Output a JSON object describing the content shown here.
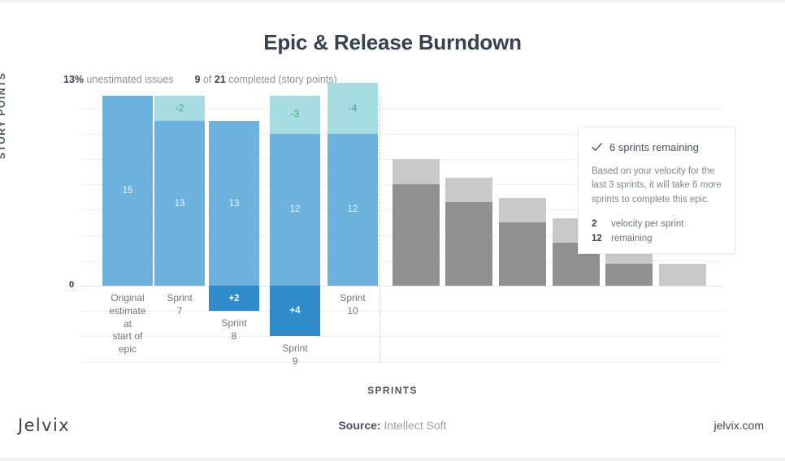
{
  "header": {
    "title": "Epic & Release Burndown"
  },
  "stats": [
    {
      "value": "13%",
      "label": "unestimated issues"
    },
    {
      "value": "9",
      "mid": "of",
      "value2": "21",
      "label": "completed (story points)"
    }
  ],
  "stats_flat": {
    "unestimated_value": "13%",
    "unestimated_label": "unestimated issues",
    "completed_value": "9",
    "completed_of": "of",
    "completed_total": "21",
    "completed_label": "completed (story points)"
  },
  "axes": {
    "y_title": "STORY POINTS",
    "x_title": "SPRINTS",
    "zero_tick": "0"
  },
  "info_card": {
    "heading": "6 sprints remaining",
    "body": "Based on your velocity for the last 3 sprints, it will take 6 more sprints to complete this epic.",
    "metrics": [
      {
        "num": "2",
        "text": "velocity per sprint"
      },
      {
        "num": "12",
        "text": "remaining"
      }
    ]
  },
  "footer": {
    "logo": "Jelvix",
    "source_strong": "Source:",
    "source_text": "Intellect Soft",
    "site": "jelvix.com"
  },
  "colors": {
    "mid_blue": "#6cb2dc",
    "light_cyan": "#a5dbe1",
    "dark_blue": "#2f8bc9",
    "gray_dark": "#909090",
    "gray_light": "#c9c9c9",
    "title": "#36424f",
    "green_label": "#3faa7e"
  },
  "chart_data": {
    "type": "bar",
    "title": "Epic & Release Burndown",
    "xlabel": "SPRINTS",
    "ylabel": "STORY POINTS",
    "grid": true,
    "legend": "none",
    "baseline": 0,
    "ylim": [
      -5,
      16
    ],
    "note": "Stacked burndown: positive segments rise above the 0 baseline, '+N' scope-added segments extend below it.",
    "categories": [
      "Original estimate at start of epic",
      "Sprint 7",
      "Sprint 8",
      "Sprint 9",
      "Sprint 10",
      "",
      "",
      "",
      "",
      "",
      ""
    ],
    "actual_bars": [
      {
        "category": "Original estimate at start of epic",
        "label": "Original\nestimate at\nstart of epic",
        "segments": [
          {
            "kind": "remaining",
            "value": 15,
            "text": "15",
            "color": "#6cb2dc"
          }
        ]
      },
      {
        "category": "Sprint 7",
        "label": "Sprint 7",
        "segments": [
          {
            "kind": "completed",
            "value": -2,
            "text": "-2",
            "color": "#a5dbe1"
          },
          {
            "kind": "remaining",
            "value": 13,
            "text": "13",
            "color": "#6cb2dc"
          }
        ]
      },
      {
        "category": "Sprint 8",
        "label": "Sprint 8",
        "segments": [
          {
            "kind": "remaining",
            "value": 13,
            "text": "13",
            "color": "#6cb2dc"
          },
          {
            "kind": "added",
            "value": 2,
            "text": "+2",
            "color": "#2f8bc9"
          }
        ]
      },
      {
        "category": "Sprint 9",
        "label": "Sprint 9",
        "segments": [
          {
            "kind": "completed",
            "value": -3,
            "text": "-3",
            "color": "#a5dbe1"
          },
          {
            "kind": "remaining",
            "value": 12,
            "text": "12",
            "color": "#6cb2dc"
          },
          {
            "kind": "added",
            "value": 4,
            "text": "+4",
            "color": "#2f8bc9"
          }
        ]
      },
      {
        "category": "Sprint 10",
        "label": "Sprint 10",
        "segments": [
          {
            "kind": "completed",
            "value": -4,
            "text": "-4",
            "color": "#a5dbe1"
          },
          {
            "kind": "remaining",
            "value": 12,
            "text": "12",
            "color": "#6cb2dc"
          }
        ]
      }
    ],
    "forecast_bars": [
      {
        "index": 1,
        "remaining": 8.0,
        "projected": 2.0
      },
      {
        "index": 2,
        "remaining": 6.6,
        "projected": 1.9
      },
      {
        "index": 3,
        "remaining": 5.0,
        "projected": 1.9
      },
      {
        "index": 4,
        "remaining": 3.4,
        "projected": 1.9
      },
      {
        "index": 5,
        "remaining": 1.7,
        "projected": 1.9
      },
      {
        "index": 6,
        "remaining": 0.0,
        "projected": 1.7
      }
    ]
  }
}
